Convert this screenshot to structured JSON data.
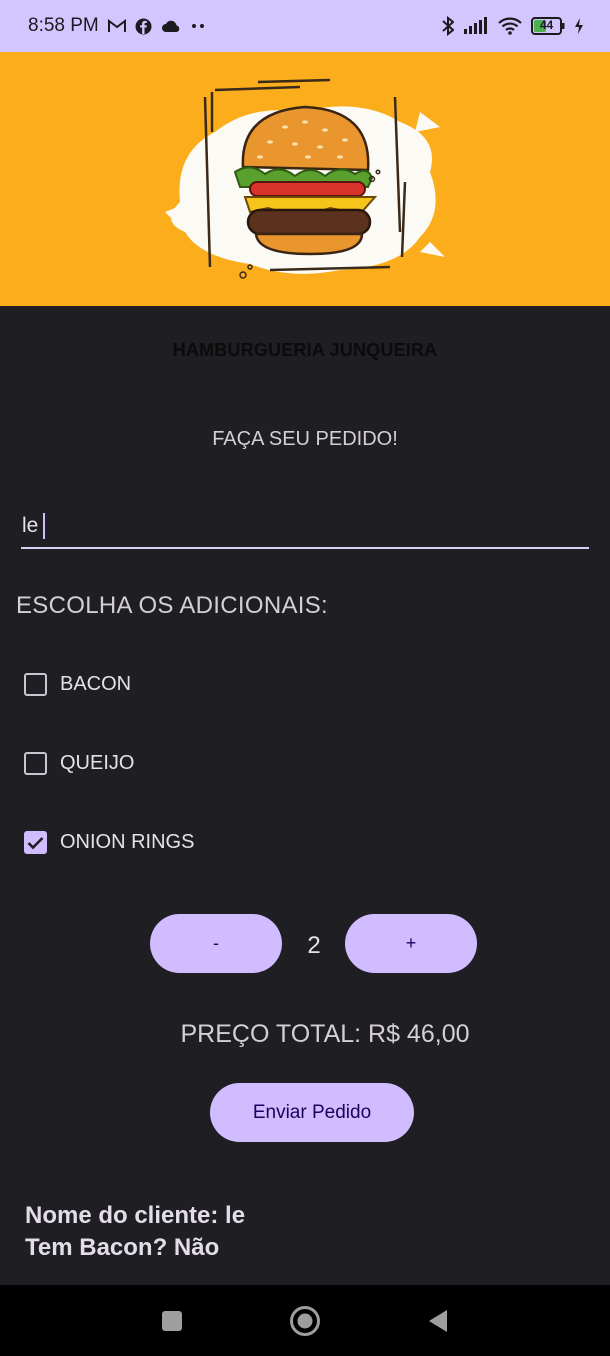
{
  "status_bar": {
    "time": "8:58 PM",
    "left_icons": [
      "gmail-icon",
      "facebook-icon",
      "cloud-icon",
      "more-dots-icon"
    ],
    "right_icons": [
      "bluetooth-icon",
      "signal-icon",
      "wifi-icon",
      "battery-icon",
      "charging-icon"
    ],
    "battery_level": "44"
  },
  "header": {
    "banner_color": "#fbad1c",
    "title": "HAMBURGUERIA JUNQUEIRA"
  },
  "order": {
    "subtitle": "FAÇA SEU PEDIDO!",
    "name_input_value": "le",
    "addons_label": "ESCOLHA OS ADICIONAIS:",
    "addons": [
      {
        "label": "BACON",
        "checked": false
      },
      {
        "label": "QUEIJO",
        "checked": false
      },
      {
        "label": "ONION RINGS",
        "checked": true
      }
    ],
    "decrement_label": "-",
    "increment_label": "+",
    "quantity": "2",
    "total": "PREÇO TOTAL: R$ 46,00",
    "submit_label": "Enviar Pedido"
  },
  "summary": {
    "line1": "Nome do cliente: le",
    "line2": "Tem Bacon? Não"
  },
  "nav_bar": {
    "icons": [
      "recents-square-icon",
      "home-circle-icon",
      "back-triangle-icon"
    ]
  },
  "colors": {
    "accent": "#d0bcff",
    "background": "#1f1e23",
    "status_bar": "#d3c6ff"
  }
}
